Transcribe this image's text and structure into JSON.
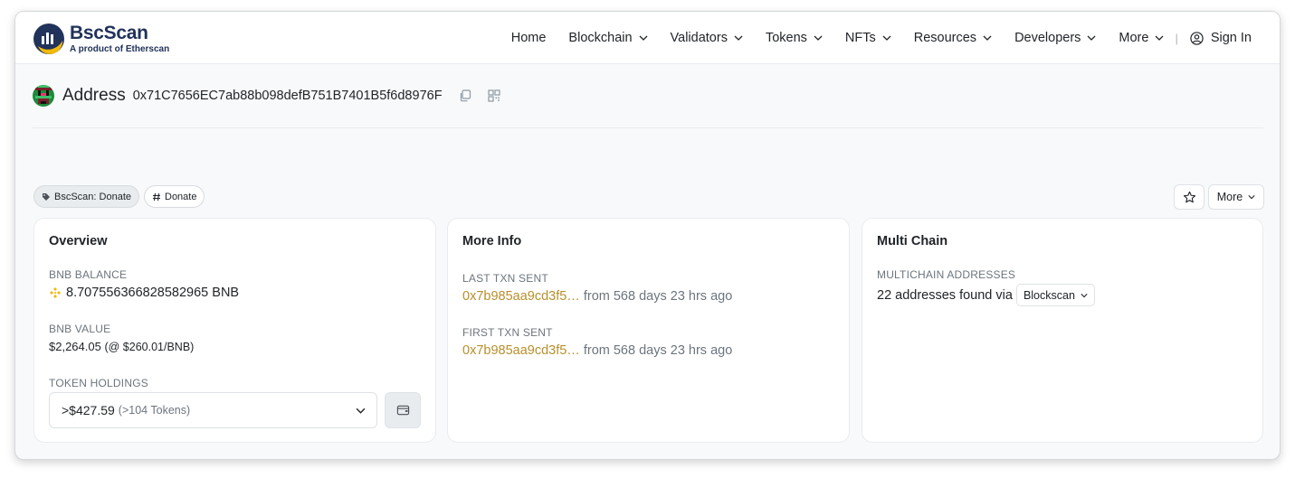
{
  "brand": {
    "name": "BscScan",
    "subtitle": "A product of Etherscan"
  },
  "nav": {
    "items": [
      {
        "label": "Home"
      },
      {
        "label": "Blockchain"
      },
      {
        "label": "Validators"
      },
      {
        "label": "Tokens"
      },
      {
        "label": "NFTs"
      },
      {
        "label": "Resources"
      },
      {
        "label": "Developers"
      },
      {
        "label": "More"
      }
    ],
    "separator": "|",
    "signin": "Sign In"
  },
  "address": {
    "title": "Address",
    "hash": "0x71C7656EC7ab88b098defB751B7401B5f6d8976F"
  },
  "tags": [
    {
      "label": "BscScan: Donate",
      "icon": "tag-icon"
    },
    {
      "label": "Donate",
      "icon": "hash-icon"
    }
  ],
  "actions": {
    "more_label": "More"
  },
  "overview": {
    "title": "Overview",
    "balance_label": "BNB BALANCE",
    "balance_value": "8.707556366828582965 BNB",
    "value_label": "BNB VALUE",
    "value_amount": "$2,264.05",
    "value_rate": "(@ $260.01/BNB)",
    "holdings_label": "TOKEN HOLDINGS",
    "holdings_value": ">$427.59",
    "holdings_count": "(>104 Tokens)"
  },
  "more_info": {
    "title": "More Info",
    "last_label": "LAST TXN SENT",
    "last_hash": "0x7b985aa9cd3f5…",
    "last_time": "from 568 days 23 hrs ago",
    "first_label": "FIRST TXN SENT",
    "first_hash": "0x7b985aa9cd3f5…",
    "first_time": "from 568 days 23 hrs ago"
  },
  "multi_chain": {
    "title": "Multi Chain",
    "label": "MULTICHAIN ADDRESSES",
    "text": "22 addresses found via",
    "dropdown": "Blockscan"
  },
  "colors": {
    "brand": "#21325b",
    "accent": "#f0b90b",
    "link": "#b78f2b"
  }
}
